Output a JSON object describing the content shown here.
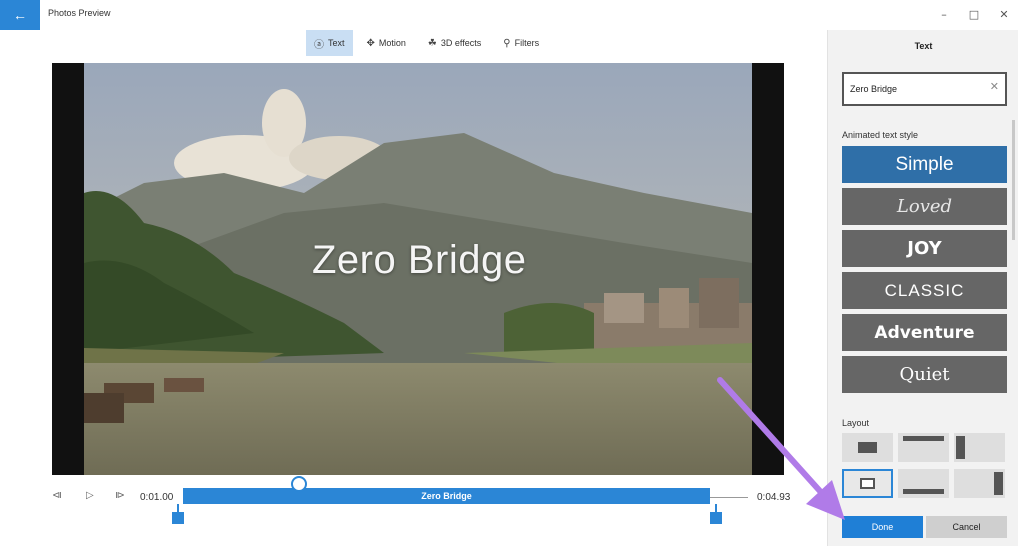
{
  "window": {
    "title": "Photos Preview",
    "back_icon": "back-arrow-icon",
    "minimize": "–",
    "maximize": "□",
    "close": "✕"
  },
  "toolbar": {
    "items": [
      {
        "label": "Text",
        "icon": "text-icon",
        "glyph": "ⓐ",
        "active": true
      },
      {
        "label": "Motion",
        "icon": "move-icon",
        "glyph": "✥",
        "active": false
      },
      {
        "label": "3D effects",
        "icon": "3d-effects-icon",
        "glyph": "☘",
        "active": false
      },
      {
        "label": "Filters",
        "icon": "filter-icon",
        "glyph": "⚲",
        "active": false
      }
    ]
  },
  "preview": {
    "overlay_text": "Zero Bridge"
  },
  "timeline": {
    "start_time": "0:01.00",
    "end_time": "0:04.93",
    "clip_label": "Zero Bridge",
    "prev_frame": "⧏",
    "play": "▷",
    "next_frame": "⧐"
  },
  "panel": {
    "title": "Text",
    "text_value": "Zero Bridge",
    "clear": "✕",
    "animated_label": "Animated text style",
    "styles": [
      {
        "label": "Simple",
        "selected": true
      },
      {
        "label": "Loved",
        "selected": false
      },
      {
        "label": "JOY",
        "selected": false
      },
      {
        "label": "CLASSIC",
        "selected": false
      },
      {
        "label": "Adventure",
        "selected": false
      },
      {
        "label": "Quiet",
        "selected": false
      }
    ],
    "layout_label": "Layout",
    "done": "Done",
    "cancel": "Cancel"
  },
  "colors": {
    "accent": "#2b86d6",
    "selected_style": "#2f6fa8",
    "style_button": "#666666",
    "annotation_arrow": "#b07be8"
  }
}
